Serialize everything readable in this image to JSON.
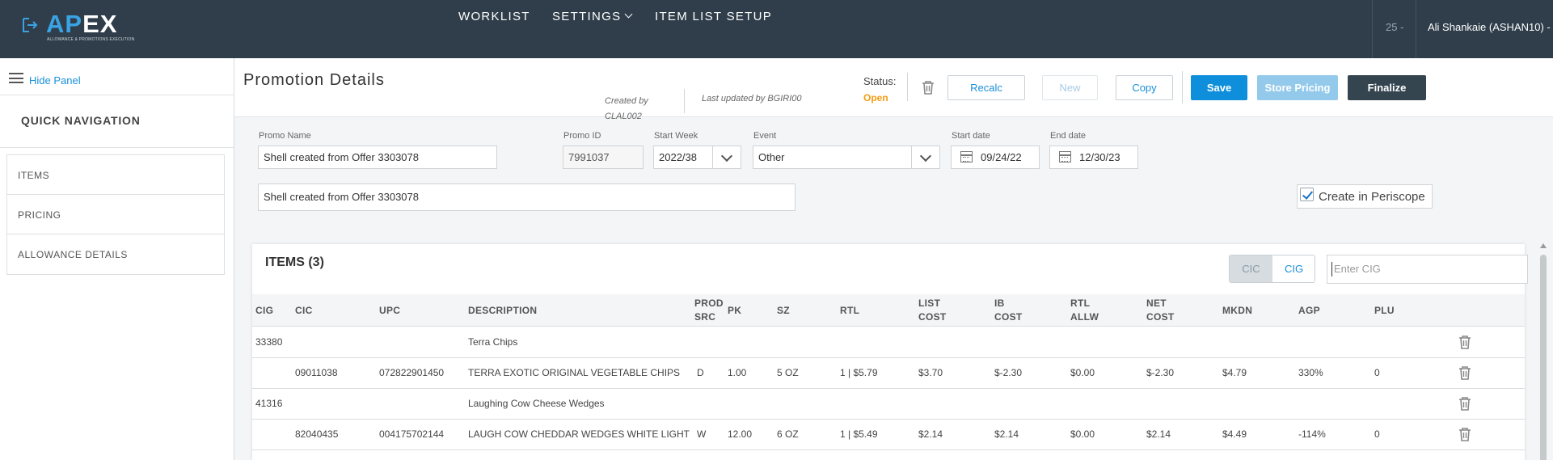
{
  "app": {
    "logo_text_a": "AP",
    "logo_text_b": "EX",
    "logo_tagline": "ALLOWANCE & PROMOTIONS EXECUTION",
    "nav": [
      {
        "label": "WORKLIST"
      },
      {
        "label": "SETTINGS"
      },
      {
        "label": "ITEM LIST SETUP"
      }
    ],
    "counter": "25 -",
    "user": "Ali Shankaie (ASHAN10) -"
  },
  "sidebar": {
    "hide_label": "Hide Panel",
    "quick_nav_title": "QUICK NAVIGATION",
    "items": [
      {
        "label": "ITEMS"
      },
      {
        "label": "PRICING"
      },
      {
        "label": "ALLOWANCE DETAILS"
      }
    ]
  },
  "header": {
    "title": "Promotion Details",
    "created_by": "Created by CLAL002",
    "updated_by": "Last updated by BGIRI00",
    "status_label": "Status:",
    "status_value": "Open",
    "buttons": {
      "recalc": "Recalc",
      "new": "New",
      "copy": "Copy",
      "save": "Save",
      "store_pricing": "Store Pricing",
      "finalize": "Finalize"
    }
  },
  "form": {
    "promo_name_label": "Promo Name",
    "promo_name": "Shell created from Offer 3303078",
    "promo_id_label": "Promo ID",
    "promo_id": "7991037",
    "start_week_label": "Start Week",
    "start_week": "2022/38",
    "event_label": "Event",
    "event": "Other",
    "start_date_label": "Start date",
    "start_date": "09/24/22",
    "end_date_label": "End date",
    "end_date": "12/30/23",
    "description": "Shell created from Offer 3303078",
    "create_in_periscope": "Create in Periscope",
    "create_in_periscope_checked": true
  },
  "items": {
    "title": "ITEMS (3)",
    "toggle": [
      "CIC",
      "CIG"
    ],
    "toggle_selected": "CIG",
    "search_placeholder": "Enter CIG",
    "columns": [
      {
        "line1": "CIG",
        "line2": ""
      },
      {
        "line1": "CIC",
        "line2": ""
      },
      {
        "line1": "UPC",
        "line2": ""
      },
      {
        "line1": "DESCRIPTION",
        "line2": ""
      },
      {
        "line1": "PROD",
        "line2": "SRC"
      },
      {
        "line1": "PK",
        "line2": ""
      },
      {
        "line1": "SZ",
        "line2": ""
      },
      {
        "line1": "RTL",
        "line2": ""
      },
      {
        "line1": "LIST",
        "line2": "COST"
      },
      {
        "line1": "IB",
        "line2": "COST"
      },
      {
        "line1": "RTL",
        "line2": "ALLW"
      },
      {
        "line1": "NET",
        "line2": "COST"
      },
      {
        "line1": "MKDN",
        "line2": ""
      },
      {
        "line1": "AGP",
        "line2": ""
      },
      {
        "line1": "PLU",
        "line2": ""
      }
    ],
    "rows": [
      {
        "cig": "33380",
        "cic": "",
        "upc": "",
        "description": "Terra Chips",
        "prod_src": "",
        "pk": "",
        "sz": "",
        "rtl": "",
        "list_cost": "",
        "ib_cost": "",
        "rtl_allw": "",
        "net_cost": "",
        "mkdn": "",
        "agp": "",
        "plu": ""
      },
      {
        "cig": "",
        "cic": "09011038",
        "upc": "072822901450",
        "description": "TERRA EXOTIC ORIGINAL VEGETABLE CHIPS",
        "prod_src": "D",
        "pk": "1.00",
        "sz": "5 OZ",
        "rtl": "1 | $5.79",
        "list_cost": "$3.70",
        "ib_cost": "$-2.30",
        "rtl_allw": "$0.00",
        "net_cost": "$-2.30",
        "mkdn": "$4.79",
        "agp": "330%",
        "plu": "0"
      },
      {
        "cig": "41316",
        "cic": "",
        "upc": "",
        "description": "Laughing Cow Cheese Wedges",
        "prod_src": "",
        "pk": "",
        "sz": "",
        "rtl": "",
        "list_cost": "",
        "ib_cost": "",
        "rtl_allw": "",
        "net_cost": "",
        "mkdn": "",
        "agp": "",
        "plu": ""
      },
      {
        "cig": "",
        "cic": "82040435",
        "upc": "004175702144",
        "description": "LAUGH COW CHEDDAR WEDGES WHITE LIGHT",
        "prod_src": "W",
        "pk": "12.00",
        "sz": "6 OZ",
        "rtl": "1 | $5.49",
        "list_cost": "$2.14",
        "ib_cost": "$2.14",
        "rtl_allw": "$0.00",
        "net_cost": "$2.14",
        "mkdn": "$4.49",
        "agp": "-114%",
        "plu": "0"
      }
    ]
  },
  "colors": {
    "topbar": "#2f3e4a",
    "accent": "#0f8fdb",
    "status_open": "#f39c12",
    "finalize": "#344550"
  }
}
